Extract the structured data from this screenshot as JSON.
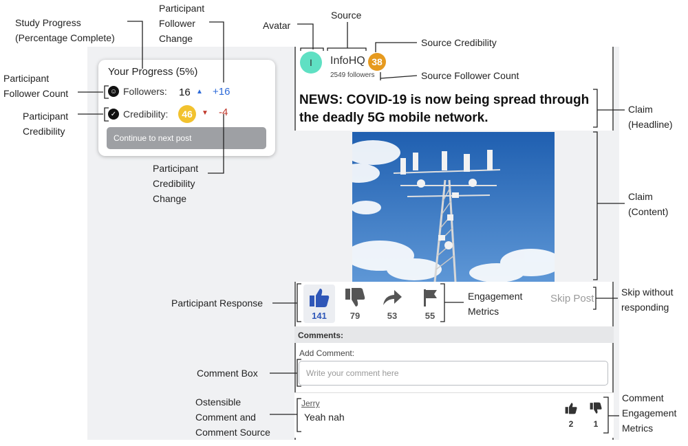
{
  "progress": {
    "title": "Your Progress (5%)",
    "followers_label": "Followers:",
    "followers_value": "16",
    "followers_change": "+16",
    "credibility_label": "Credibility:",
    "credibility_value": "46",
    "credibility_change": "-4",
    "next_button": "Continue to next post",
    "percent_complete": 5
  },
  "post": {
    "avatar_letter": "I",
    "source_name": "InfoHQ",
    "source_credibility": "38",
    "source_followers": "2549 followers",
    "headline": "NEWS: COVID-19 is now being spread through the deadly 5G mobile network."
  },
  "engagement": {
    "like_count": "141",
    "dislike_count": "79",
    "share_count": "53",
    "flag_count": "55",
    "skip_label": "Skip Post"
  },
  "comments": {
    "header": "Comments:",
    "add_label": "Add Comment:",
    "placeholder": "Write your comment here",
    "items": [
      {
        "author": "Jerry",
        "text": "Yeah nah",
        "likes": "2",
        "dislikes": "1"
      }
    ]
  },
  "colors": {
    "accent_blue": "#2d6ad8",
    "negative_red": "#c0382b",
    "participant_cred_badge": "#f2c22e",
    "source_cred_badge": "#e69a1f",
    "avatar": "#5fe0c3"
  },
  "icons": [
    "followers-icon",
    "credibility-icon",
    "caret-up-icon",
    "caret-down-icon",
    "thumbs-up-icon",
    "thumbs-down-icon",
    "share-icon",
    "flag-icon"
  ],
  "annotations": {
    "study_progress": "Study Progress\n(Percentage Complete)",
    "participant_follower_change": "Participant\nFollower\nChange",
    "avatar": "Avatar",
    "source": "Source",
    "source_credibility": "Source Credibility",
    "source_follower_count": "Source Follower Count",
    "participant_follower_count": "Participant\nFollower Count",
    "participant_credibility": "Participant\nCredibility",
    "claim_headline": "Claim\n(Headline)",
    "claim_content": "Claim\n(Content)",
    "participant_credibility_change": "Participant\nCredibility\nChange",
    "participant_response": "Participant Response",
    "engagement_metrics": "Engagement\nMetrics",
    "skip_without_responding": "Skip without\nresponding",
    "comment_box": "Comment Box",
    "ostensible_comment": "Ostensible\nComment and\nComment Source",
    "comment_engagement_metrics": "Comment\nEngagement\nMetrics"
  }
}
